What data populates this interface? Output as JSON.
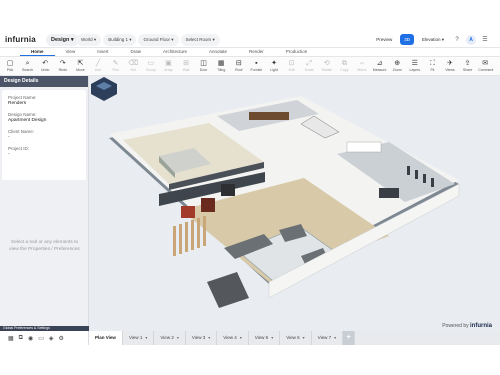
{
  "app": {
    "logo": "infurnia",
    "mode": "Design ▾",
    "breadcrumbs": [
      "World ▾",
      "Building 1 ▾",
      "Ground Floor ▾",
      "Select Room ▾"
    ],
    "top_actions": {
      "preview": "Preview",
      "view3d": "3D",
      "elevation": "Elevation ▾",
      "help": "?",
      "avatar": "A"
    }
  },
  "tabs": [
    "Home",
    "View",
    "Insert",
    "Draw",
    "Architecture",
    "Annotate",
    "Render",
    "Production"
  ],
  "active_tab": "Home",
  "toolbar": [
    {
      "icon": "▢",
      "label": "Pick",
      "dim": false
    },
    {
      "icon": "⌕",
      "label": "Search",
      "dim": false
    },
    {
      "icon": "↶",
      "label": "Undo",
      "dim": false
    },
    {
      "icon": "↷",
      "label": "Redo",
      "dim": false
    },
    {
      "icon": "⇱",
      "label": "Move",
      "dim": false
    },
    {
      "icon": "╱",
      "label": "Line",
      "dim": true
    },
    {
      "icon": "✎",
      "label": "Pen",
      "dim": true
    },
    {
      "icon": "⌫",
      "label": "Del",
      "dim": true
    },
    {
      "icon": "▭",
      "label": "Group",
      "dim": true
    },
    {
      "icon": "▣",
      "label": "Array",
      "dim": true
    },
    {
      "icon": "⊞",
      "label": "Wall",
      "dim": true
    },
    {
      "icon": "◫",
      "label": "Door",
      "dim": false
    },
    {
      "icon": "▦",
      "label": "Tiling",
      "dim": false
    },
    {
      "icon": "⊟",
      "label": "Roof",
      "dim": false
    },
    {
      "icon": "▪",
      "label": "Furnish",
      "dim": false
    },
    {
      "icon": "✦",
      "label": "Light",
      "dim": false
    },
    {
      "icon": "⊡",
      "label": "Edit",
      "dim": true
    },
    {
      "icon": "⤢",
      "label": "Scale",
      "dim": true
    },
    {
      "icon": "⟲",
      "label": "Rotate",
      "dim": true
    },
    {
      "icon": "⧉",
      "label": "Copy",
      "dim": true
    },
    {
      "icon": "⇔",
      "label": "Mirror",
      "dim": true
    },
    {
      "icon": "⊿",
      "label": "Measure",
      "dim": false
    },
    {
      "icon": "⊕",
      "label": "Zoom",
      "dim": false
    },
    {
      "icon": "☰",
      "label": "Layers",
      "dim": false
    },
    {
      "icon": "⛶",
      "label": "Fit",
      "dim": false
    },
    {
      "icon": "✈",
      "label": "Views",
      "dim": false
    },
    {
      "icon": "⇪",
      "label": "Share",
      "dim": false
    },
    {
      "icon": "✉",
      "label": "Comment",
      "dim": false
    }
  ],
  "panel": {
    "title": "Design Details",
    "fields": [
      {
        "label": "Project Name:",
        "value": "Renders"
      },
      {
        "label": "Design Name:",
        "value": "Apartment Design"
      },
      {
        "label": "Client Name:",
        "value": "-"
      },
      {
        "label": "Project ID:",
        "value": "-"
      }
    ],
    "hint": "Select a tool or any elements to view the Properties / Preferences",
    "footer": "Global Preferences & Settings"
  },
  "bottom_tabs": [
    "Plan View",
    "View 1",
    "View 2",
    "View 3",
    "View 4",
    "View 5",
    "View 6",
    "View 7"
  ],
  "active_bottom_tab": "Plan View",
  "watermark": {
    "prefix": "Powered by",
    "brand": "infurnia"
  },
  "colors": {
    "accent": "#1f6fe5",
    "panel_header": "#4b5567",
    "floor": "#d8c9a8",
    "wall": "#f4f4f2"
  }
}
